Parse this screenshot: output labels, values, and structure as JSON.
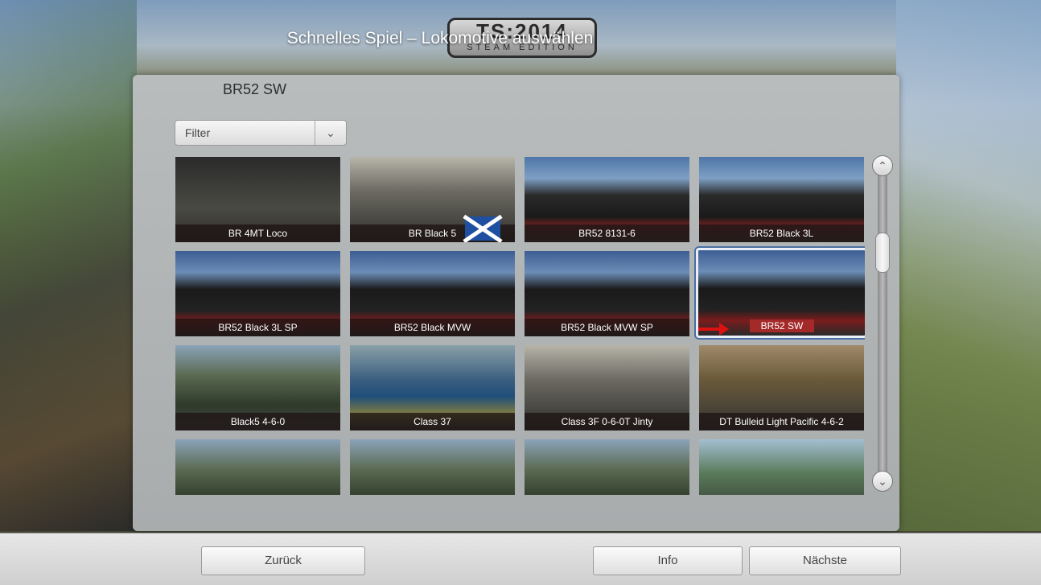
{
  "header": {
    "title": "Schnelles Spiel – Lokomotive auswählen",
    "logo_line1": "TS:2014",
    "logo_line2": "STEAM EDITION"
  },
  "panel": {
    "selected_name": "BR52 SW",
    "filter_label": "Filter",
    "filter_icon": "chevron-down-icon"
  },
  "locomotives": [
    {
      "name": "BR 4MT Loco",
      "selected": false
    },
    {
      "name": "BR Black 5",
      "selected": false
    },
    {
      "name": "BR52 8131-6",
      "selected": false
    },
    {
      "name": "BR52 Black 3L",
      "selected": false
    },
    {
      "name": "BR52 Black 3L SP",
      "selected": false
    },
    {
      "name": "BR52 Black MVW",
      "selected": false
    },
    {
      "name": "BR52 Black MVW SP",
      "selected": false
    },
    {
      "name": "BR52 SW",
      "selected": true
    },
    {
      "name": "Black5 4-6-0",
      "selected": false
    },
    {
      "name": "Class 37",
      "selected": false
    },
    {
      "name": "Class 3F 0-6-0T Jinty",
      "selected": false
    },
    {
      "name": "DT Bulleid Light Pacific 4-6-2",
      "selected": false
    },
    {
      "name": "",
      "selected": false
    },
    {
      "name": "",
      "selected": false
    },
    {
      "name": "",
      "selected": false
    },
    {
      "name": "",
      "selected": false
    }
  ],
  "scrollbar": {
    "up_icon": "chevron-up-icon",
    "down_icon": "chevron-down-icon"
  },
  "footer": {
    "back_label": "Zurück",
    "info_label": "Info",
    "next_label": "Nächste"
  }
}
